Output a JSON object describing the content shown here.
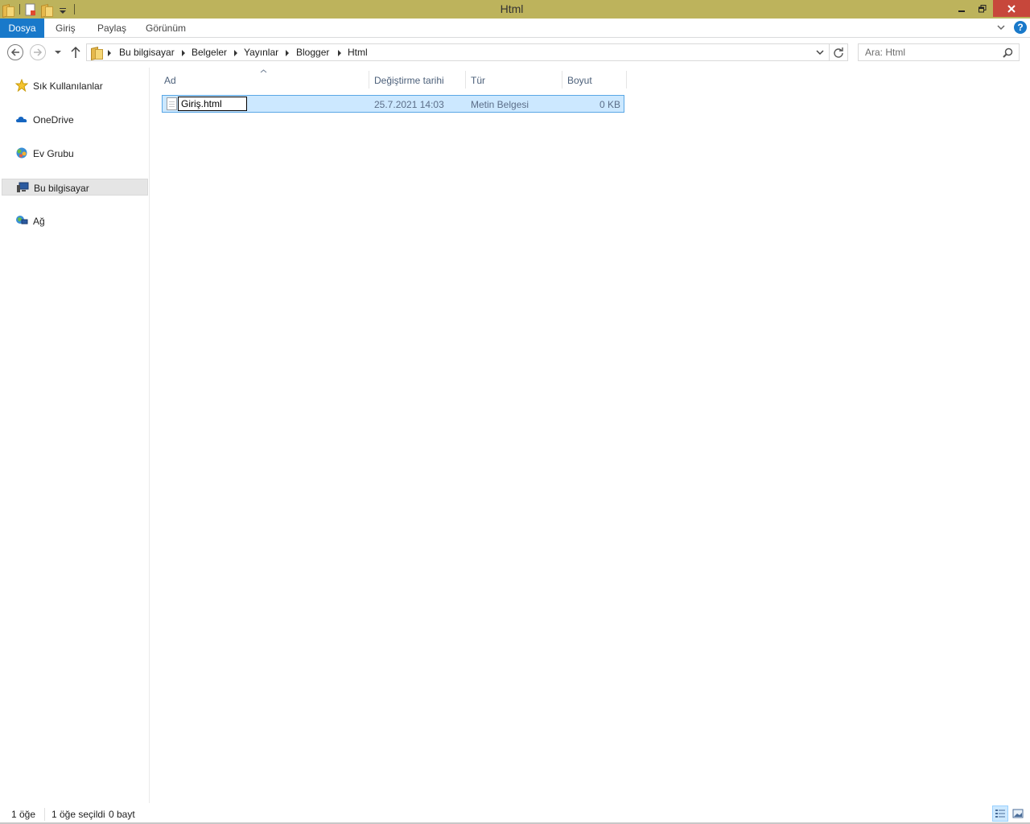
{
  "window": {
    "title": "Html"
  },
  "ribbon": {
    "tabs": [
      "Dosya",
      "Giriş",
      "Paylaş",
      "Görünüm"
    ]
  },
  "address": {
    "crumbs": [
      "Bu bilgisayar",
      "Belgeler",
      "Yayınlar",
      "Blogger",
      "Html"
    ]
  },
  "search": {
    "placeholder": "Ara: Html"
  },
  "nav": {
    "items": [
      "Sık Kullanılanlar",
      "OneDrive",
      "Ev Grubu",
      "Bu bilgisayar",
      "Ağ"
    ]
  },
  "columns": {
    "name": "Ad",
    "modified": "Değiştirme tarihi",
    "type": "Tür",
    "size": "Boyut"
  },
  "files": [
    {
      "name": "Giriş.html",
      "modified": "25.7.2021 14:03",
      "type": "Metin Belgesi",
      "size": "0 KB"
    }
  ],
  "status": {
    "count": "1 öğe",
    "selected": "1 öğe seçildi",
    "bytes": "0 bayt"
  },
  "colors": {
    "accent": "#1979ca",
    "titlebar": "#bdb35c",
    "selection": "#cce8ff",
    "close": "#c7473b"
  }
}
